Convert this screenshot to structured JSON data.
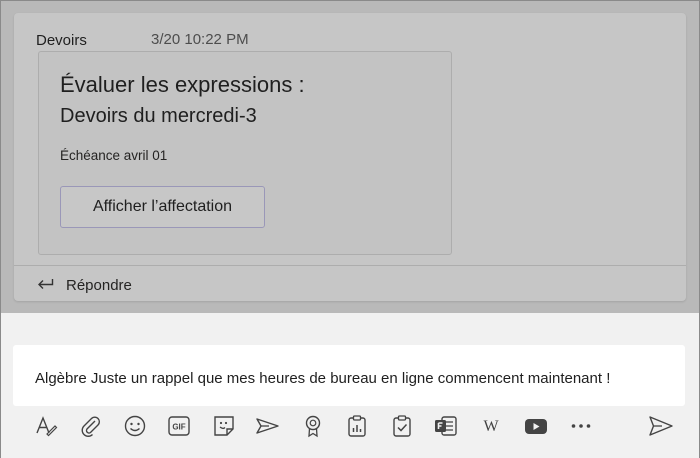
{
  "post": {
    "author": "Devoirs",
    "timestamp": "3/20 10:22 PM",
    "assignment": {
      "title_line1": "Évaluer les expressions :",
      "title_line2": "Devoirs du mercredi-3",
      "due": "Échéance avril 01",
      "view_button": "Afficher l’affectation"
    },
    "reply_label": "Répondre"
  },
  "compose": {
    "message": "Algèbre Juste un rappel que mes heures de bureau en ligne commencent maintenant !",
    "toolbar": {
      "gif_label": "GIF",
      "wiki_label": "W",
      "icons": [
        "format-icon",
        "attach-icon",
        "emoji-icon",
        "gif-icon",
        "sticker-icon",
        "meet-icon",
        "praise-icon",
        "insights-icon",
        "assignments-icon",
        "forms-icon",
        "wikipedia-icon",
        "youtube-icon",
        "more-icon",
        "send-icon"
      ]
    }
  },
  "colors": {
    "overlay_gray": "#b9b9b9",
    "compose_bg": "#f1f1f1",
    "accent": "#9a97b8"
  }
}
